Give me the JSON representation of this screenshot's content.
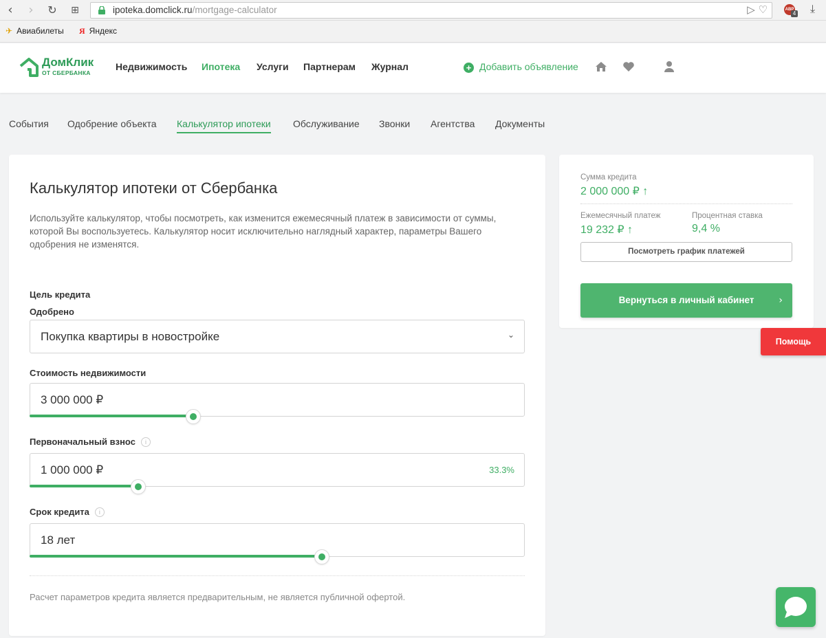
{
  "browser": {
    "url_domain": "ipoteka.domclick.ru",
    "url_path": "/mortgage-calculator",
    "extension_badge": "4",
    "extension_label": "ABP",
    "bookmarks": [
      {
        "label": "Авиабилеты",
        "icon": "plane-icon"
      },
      {
        "label": "Яндекс",
        "icon": "yandex-icon"
      }
    ]
  },
  "header": {
    "logo_title": "ДомКлик",
    "logo_subtitle": "ОТ СБЕРБАНКА",
    "nav": [
      "Недвижимость",
      "Ипотека",
      "Услуги",
      "Партнерам",
      "Журнал"
    ],
    "active_nav": "Ипотека",
    "add_listing": "Добавить объявление"
  },
  "subtabs": [
    "События",
    "Одобрение объекта",
    "Калькулятор ипотеки",
    "Обслуживание",
    "Звонки",
    "Агентства",
    "Документы"
  ],
  "active_subtab": "Калькулятор ипотеки",
  "calculator": {
    "title": "Калькулятор ипотеки от Сбербанка",
    "description": "Используйте калькулятор, чтобы посмотреть, как изменится ежемесячный платеж в зависимости от суммы, которой Вы воспользуетесь. Калькулятор носит исключительно наглядный характер, параметры Вашего одобрения не изменятся.",
    "purpose_label": "Цель кредита",
    "approved_label": "Одобрено",
    "purpose_value": "Покупка квартиры в новостройке",
    "property_label": "Стоимость недвижимости",
    "property_value": "3 000 000 ₽",
    "property_slider_level": 0.33,
    "downpayment_label": "Первоначальный взнос",
    "downpayment_value": "1 000 000 ₽",
    "downpayment_percent": "33.3%",
    "downpayment_slider_level": 0.22,
    "term_label": "Срок кредита",
    "term_value": "18 лет",
    "term_slider_level": 0.59,
    "info_symbol": "i",
    "disclaimer": "Расчет параметров кредита является предварительным, не является публичной офертой."
  },
  "summary": {
    "loan_amount_label": "Сумма кредита",
    "loan_amount_value": "2 000 000 ₽ ↑",
    "monthly_label": "Ежемесячный платеж",
    "monthly_value": "19 232 ₽ ↑",
    "rate_label": "Процентная ставка",
    "rate_value": "9,4 %",
    "schedule_button": "Посмотреть график платежей",
    "cabinet_button": "Вернуться в личный кабинет"
  },
  "help_button": "Помощь",
  "colors": {
    "accent": "#3fae64",
    "brand": "#2d9b57",
    "help": "#f0383b"
  }
}
